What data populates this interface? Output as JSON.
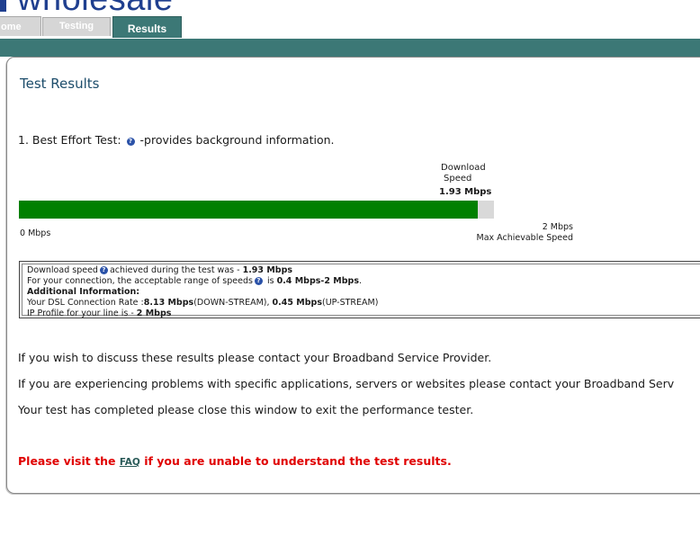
{
  "brand": {
    "logo_text": "wholesale"
  },
  "tabs": [
    {
      "label": "ome"
    },
    {
      "label": "Testing"
    },
    {
      "label": "Results"
    }
  ],
  "page": {
    "title": "Test Results"
  },
  "best_effort": {
    "label": "1. Best Effort Test:",
    "help_icon": "question-icon",
    "description": "-provides background information."
  },
  "download": {
    "header_line1": "Download",
    "header_line2": "Speed",
    "value": "1.93 Mbps",
    "fill_fraction": 0.965,
    "min_label": "0 Mbps",
    "max_label": "2 Mbps",
    "max_caption": "Max Achievable Speed",
    "bar_color": "#008000"
  },
  "info": {
    "line1_pre": "Download speed",
    "line1_post": "achieved during the test was - ",
    "line1_value": "1.93 Mbps",
    "line2_pre": "For your connection, the acceptable range of speeds",
    "line2_mid": " is ",
    "line2_value": "0.4 Mbps-2 Mbps",
    "line2_end": ".",
    "additional_heading": "Additional Information:",
    "dsl_pre": "Your DSL Connection Rate :",
    "dsl_down": "8.13 Mbps",
    "dsl_down_label": "(DOWN-STREAM), ",
    "dsl_up": "0.45 Mbps",
    "dsl_up_label": "(UP-STREAM)",
    "ip_pre": "IP Profile for your line is - ",
    "ip_value": "2 Mbps"
  },
  "messages": [
    "If you wish to discuss these results please contact your Broadband Service Provider.",
    "If you are experiencing problems with specific applications, servers or websites please contact your Broadband Serv",
    "Your test has completed please close this window to exit the performance tester."
  ],
  "faq": {
    "pre": "Please visit the ",
    "link": "FAQ",
    "post": " if you are unable to understand the test results."
  },
  "colors": {
    "brand_blue": "#1f3f8f",
    "teal": "#3c7876",
    "alert_red": "#e00000",
    "success_green": "#008000"
  }
}
